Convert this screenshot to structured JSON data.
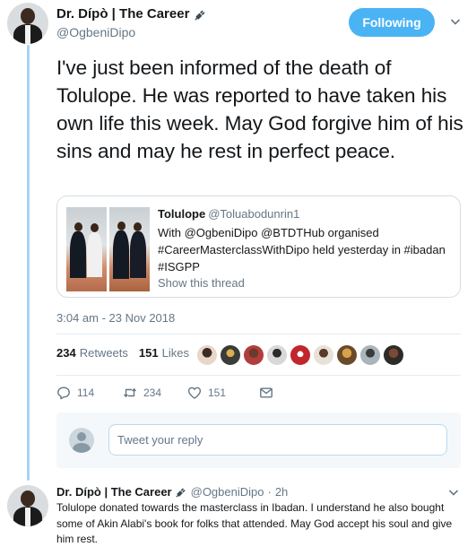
{
  "tweet": {
    "author": {
      "display_name": "Dr. Dípò | The Career",
      "handle": "@OgbeniDipo",
      "badge_icon": "plug-emoji-icon"
    },
    "follow_button_label": "Following",
    "text": "I've just been informed of the death of Tolulope. He was reported to have taken his own life this week. May God forgive him of his sins and may he rest in perfect peace.",
    "timestamp": "3:04 am - 23 Nov 2018",
    "stats": {
      "retweets_count": "234",
      "retweets_label": "Retweets",
      "likes_count": "151",
      "likes_label": "Likes"
    },
    "actions": {
      "reply_count": "114",
      "retweet_count": "234",
      "like_count": "151"
    }
  },
  "quoted_tweet": {
    "display_name": "Tolulope",
    "handle": "@Toluabodunrin1",
    "text": "With @OgbeniDipo @BTDTHub organised #CareerMasterclassWithDipo held yesterday in #ibadan #ISGPP",
    "show_thread_label": "Show this thread"
  },
  "reply_composer": {
    "placeholder": "Tweet your reply"
  },
  "reply": {
    "display_name": "Dr. Dípò | The Career",
    "handle": "@OgbeniDipo",
    "separator": "·",
    "time": "2h",
    "text": "Tolulope donated towards the masterclass in Ibadan. I understand he also bought some of Akin Alabi's book for folks that attended. May God accept his soul and give him rest."
  },
  "colors": {
    "accent": "#4ab3f4",
    "secondary_text": "#657786",
    "thread_line": "#a6d4f2"
  }
}
